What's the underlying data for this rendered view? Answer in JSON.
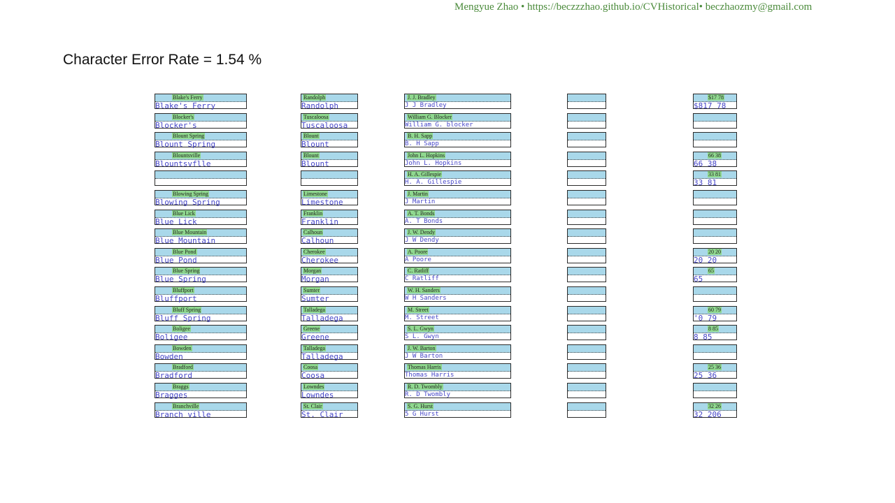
{
  "header": {
    "text": "Mengyue  Zhao  • https://beczzzhao.github.io/CVHistorical•  beczhaozmy@gmail.com"
  },
  "title": "Character Error Rate = 1.54 %",
  "columns": [
    {
      "rows": [
        {
          "orig": "Blake's Ferry",
          "pred": "Blake's Ferry"
        },
        {
          "orig": "Blocker's",
          "pred": "Blocker's"
        },
        {
          "orig": "Blount Spring",
          "pred": "Blount Spring"
        },
        {
          "orig": "Blountsville",
          "pred": "Blountsvflle"
        },
        {
          "orig": "",
          "pred": ""
        },
        {
          "orig": "Blowing Spring",
          "pred": "Blowing Spring"
        },
        {
          "orig": "Blue Lick",
          "pred": "Blue Lick"
        },
        {
          "orig": "Blue Mountain",
          "pred": "Blue Mountain"
        },
        {
          "orig": "Blue Pond",
          "pred": "Blue Pond"
        },
        {
          "orig": "Blue Spring",
          "pred": "Blue Spring"
        },
        {
          "orig": "Bluffport",
          "pred": "Bluffport"
        },
        {
          "orig": "Bluff Spring",
          "pred": "Bluff Spring"
        },
        {
          "orig": "Boligee",
          "pred": "Boligee"
        },
        {
          "orig": "Bowden",
          "pred": "Bowden"
        },
        {
          "orig": "Bradford",
          "pred": "Bradford"
        },
        {
          "orig": "Braggs",
          "pred": "Bragges"
        },
        {
          "orig": "Branchville",
          "pred": "Branch ville"
        }
      ]
    },
    {
      "rows": [
        {
          "orig": "Randolph",
          "pred": "Randolph"
        },
        {
          "orig": "Tuscaloosa",
          "pred": "Tuscaloosa"
        },
        {
          "orig": "Blount",
          "pred": "Blount"
        },
        {
          "orig": "Blount",
          "pred": "Blount"
        },
        {
          "orig": "",
          "pred": ""
        },
        {
          "orig": "Limestone",
          "pred": "Limestone"
        },
        {
          "orig": "Franklin",
          "pred": "Franklin"
        },
        {
          "orig": "Calhoun",
          "pred": "Calhoun"
        },
        {
          "orig": "Cherokee",
          "pred": "Cherokee"
        },
        {
          "orig": "Morgan",
          "pred": "Morgan"
        },
        {
          "orig": "Sumter",
          "pred": "Sumter"
        },
        {
          "orig": "Talladega",
          "pred": "Talladega"
        },
        {
          "orig": "Greene",
          "pred": "Greene"
        },
        {
          "orig": "Talladega",
          "pred": "Talladega"
        },
        {
          "orig": "Coosa",
          "pred": "Coosa"
        },
        {
          "orig": "Lowndes",
          "pred": "Lowndes"
        },
        {
          "orig": "St. Clair",
          "pred": "St. Clair"
        }
      ]
    },
    {
      "rows": [
        {
          "orig": "J. J. Bradley",
          "pred": "J J Bradley"
        },
        {
          "orig": "William G. Blocker",
          "pred": "William G.   blocker"
        },
        {
          "orig": "B. H. Sapp",
          "pred": "B. H Sapp"
        },
        {
          "orig": "John L. Hopkins",
          "pred": "John L. Hopkins"
        },
        {
          "orig": "H. A. Gillespie",
          "pred": "H. A. Gillespie"
        },
        {
          "orig": "J. Martin",
          "pred": "J Martin"
        },
        {
          "orig": "A. T. Bonds",
          "pred": "A. T Bonds"
        },
        {
          "orig": "J. W. Dendy",
          "pred": "J W Dendy"
        },
        {
          "orig": "A. Poore",
          "pred": "A Poore"
        },
        {
          "orig": "C. Ratliff",
          "pred": "C Ratliff"
        },
        {
          "orig": "W. H. Sanders",
          "pred": "W H Sanders"
        },
        {
          "orig": "M. Street",
          "pred": "M. Street"
        },
        {
          "orig": "S. L. Gwyn",
          "pred": "S L. Gwyn"
        },
        {
          "orig": "J. W. Barton",
          "pred": "J W Barton"
        },
        {
          "orig": "Thomas Harris",
          "pred": "Thomas Harris"
        },
        {
          "orig": "R. D. Twombly",
          "pred": "R. D Twombly"
        },
        {
          "orig": "S. G. Hurst",
          "pred": "5 G Hurst"
        }
      ]
    },
    {
      "rows": [
        {
          "orig": "",
          "pred": ""
        },
        {
          "orig": "",
          "pred": ""
        },
        {
          "orig": "",
          "pred": ""
        },
        {
          "orig": "",
          "pred": ""
        },
        {
          "orig": "",
          "pred": ""
        },
        {
          "orig": "",
          "pred": ""
        },
        {
          "orig": "",
          "pred": ""
        },
        {
          "orig": "",
          "pred": ""
        },
        {
          "orig": "",
          "pred": ""
        },
        {
          "orig": "",
          "pred": ""
        },
        {
          "orig": "",
          "pred": ""
        },
        {
          "orig": "",
          "pred": ""
        },
        {
          "orig": "",
          "pred": ""
        },
        {
          "orig": "",
          "pred": ""
        },
        {
          "orig": "",
          "pred": ""
        },
        {
          "orig": "",
          "pred": ""
        },
        {
          "orig": "",
          "pred": ""
        }
      ]
    },
    {
      "rows": [
        {
          "orig": "$17 78",
          "pred": "$817 78"
        },
        {
          "orig": "",
          "pred": ""
        },
        {
          "orig": "",
          "pred": ""
        },
        {
          "orig": "66 38",
          "pred": "66 38"
        },
        {
          "orig": "33 81",
          "pred": "33 81"
        },
        {
          "orig": "",
          "pred": ""
        },
        {
          "orig": "",
          "pred": ""
        },
        {
          "orig": "",
          "pred": ""
        },
        {
          "orig": "20 20",
          "pred": "20 20"
        },
        {
          "orig": "65",
          "pred": "65"
        },
        {
          "orig": "",
          "pred": ""
        },
        {
          "orig": "60 79",
          "pred": "'0 79"
        },
        {
          "orig": "8 85",
          "pred": "8 85"
        },
        {
          "orig": "",
          "pred": ""
        },
        {
          "orig": "25 36",
          "pred": "25 36"
        },
        {
          "orig": "",
          "pred": ""
        },
        {
          "orig": "32 26",
          "pred": "32 206"
        }
      ]
    }
  ]
}
